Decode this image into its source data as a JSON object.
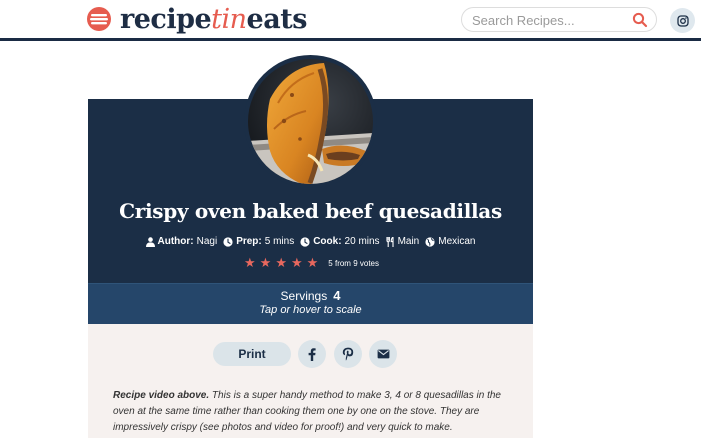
{
  "header": {
    "logo": {
      "word1": "recipe",
      "word2": "tin",
      "word3": "eats"
    },
    "search": {
      "placeholder": "Search Recipes..."
    },
    "icons": {
      "search": "search-icon",
      "social": "instagram-icon"
    }
  },
  "recipe": {
    "title": "Crispy oven baked beef quesadillas",
    "meta": {
      "author_label": "Author:",
      "author": "Nagi",
      "prep_label": "Prep:",
      "prep": "5 mins",
      "cook_label": "Cook:",
      "cook": "20 mins",
      "course": "Main",
      "cuisine": "Mexican"
    },
    "rating": {
      "stars": 5,
      "max_stars": 5,
      "votes_text": "5 from 9 votes"
    },
    "servings": {
      "label": "Servings",
      "value": "4",
      "hint": "Tap or hover to scale"
    },
    "actions": {
      "print_label": "Print",
      "share_icons": [
        "facebook-icon",
        "pinterest-icon",
        "email-icon"
      ]
    },
    "description": {
      "lead": "Recipe video above.",
      "body": " This is a super handy method to make 3, 4 or 8 quesadillas in the oven at the same time rather than cooking them one by one on the stove. They are impressively crispy (see photos and video for proof!) and very quick to make."
    }
  },
  "colors": {
    "brand_navy": "#1b2e46",
    "brand_coral": "#e65c4f",
    "servings_band": "#25466a",
    "light_panel": "#f6f1ef",
    "button_bg": "#dbe4e9",
    "star": "#e8685e"
  }
}
